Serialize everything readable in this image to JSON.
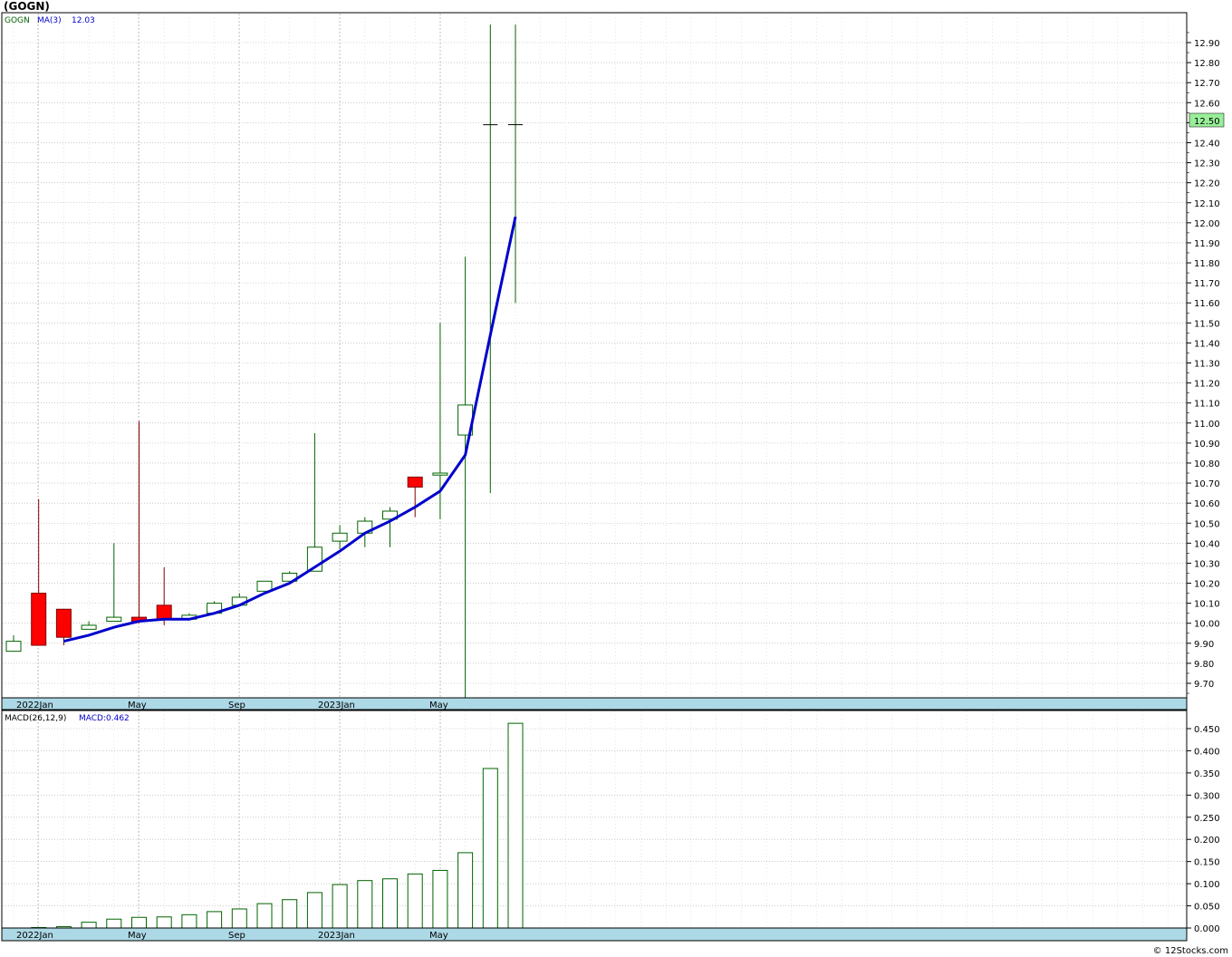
{
  "title": "(GOGN)",
  "footer": "© 12Stocks.com",
  "price_panel": {
    "legend_symbol": "GOGN",
    "legend_ma": "MA(3)",
    "legend_ma_value": "12.03",
    "last_price_label": "12.50",
    "y_ticks": [
      "9.70",
      "9.80",
      "9.90",
      "10.00",
      "10.10",
      "10.20",
      "10.30",
      "10.40",
      "10.50",
      "10.60",
      "10.70",
      "10.80",
      "10.90",
      "11.00",
      "11.10",
      "11.20",
      "11.30",
      "11.40",
      "11.50",
      "11.60",
      "11.70",
      "11.80",
      "11.90",
      "12.00",
      "12.10",
      "12.20",
      "12.30",
      "12.40",
      "12.50",
      "12.60",
      "12.70",
      "12.80",
      "12.90"
    ],
    "date_labels": [
      "2022Jan",
      "May",
      "Sep",
      "2023Jan",
      "May"
    ]
  },
  "macd_panel": {
    "legend_name": "MACD(26,12,9)",
    "legend_value": "MACD:0.462",
    "y_ticks": [
      "0.000",
      "0.050",
      "0.100",
      "0.150",
      "0.200",
      "0.250",
      "0.300",
      "0.350",
      "0.400",
      "0.450"
    ],
    "date_labels": [
      "2022Jan",
      "May",
      "Sep",
      "2023Jan",
      "May"
    ]
  },
  "colors": {
    "up_outline": "#006400",
    "down_fill": "#ff0000",
    "ma_line": "#0000cc",
    "last_price_bg": "#99ee99",
    "date_bar": "#add8e6",
    "grid": "#aaaaaa"
  },
  "chart_data": [
    {
      "type": "candlestick",
      "interval": "monthly",
      "x": [
        "2021-12",
        "2022-01",
        "2022-02",
        "2022-03",
        "2022-04",
        "2022-05",
        "2022-06",
        "2022-07",
        "2022-08",
        "2022-09",
        "2022-10",
        "2022-11",
        "2022-12",
        "2023-01",
        "2023-02",
        "2023-03",
        "2023-04",
        "2023-05",
        "2023-06",
        "2023-07",
        "2023-08"
      ],
      "open": [
        9.86,
        10.15,
        10.07,
        9.97,
        10.01,
        10.03,
        10.09,
        10.02,
        10.05,
        10.09,
        10.16,
        10.21,
        10.26,
        10.41,
        10.45,
        10.52,
        10.73,
        10.74,
        10.94,
        12.49,
        12.49
      ],
      "close": [
        9.91,
        9.89,
        9.93,
        9.99,
        10.03,
        10.01,
        10.02,
        10.04,
        10.1,
        10.13,
        10.21,
        10.25,
        10.38,
        10.45,
        10.51,
        10.56,
        10.68,
        10.75,
        11.09,
        12.49,
        12.49
      ],
      "high": [
        9.94,
        10.62,
        10.07,
        10.01,
        10.4,
        11.01,
        10.28,
        10.05,
        10.11,
        10.15,
        10.21,
        10.26,
        10.95,
        10.49,
        10.53,
        10.58,
        10.7,
        11.5,
        11.83,
        12.99,
        12.99
      ],
      "low": [
        9.86,
        9.89,
        9.89,
        9.97,
        10.01,
        10.0,
        9.99,
        10.02,
        10.05,
        10.09,
        10.16,
        10.21,
        10.26,
        10.37,
        10.38,
        10.38,
        10.53,
        10.52,
        9.63,
        10.65,
        11.6
      ],
      "ma3": [
        null,
        null,
        9.91,
        9.94,
        9.98,
        10.01,
        10.02,
        10.02,
        10.05,
        10.09,
        10.15,
        10.2,
        10.28,
        10.36,
        10.45,
        10.51,
        10.58,
        10.66,
        10.84,
        11.44,
        12.03
      ],
      "ylim": [
        9.63,
        13.0
      ]
    },
    {
      "type": "bar",
      "name": "MACD(26,12,9)",
      "x": [
        "2021-12",
        "2022-01",
        "2022-02",
        "2022-03",
        "2022-04",
        "2022-05",
        "2022-06",
        "2022-07",
        "2022-08",
        "2022-09",
        "2022-10",
        "2022-11",
        "2022-12",
        "2023-01",
        "2023-02",
        "2023-03",
        "2023-04",
        "2023-05",
        "2023-06",
        "2023-07",
        "2023-08"
      ],
      "values": [
        0.0,
        0.001,
        0.003,
        0.013,
        0.02,
        0.024,
        0.025,
        0.03,
        0.037,
        0.043,
        0.055,
        0.064,
        0.08,
        0.098,
        0.107,
        0.111,
        0.122,
        0.13,
        0.17,
        0.36,
        0.462
      ],
      "ylim": [
        0,
        0.46
      ]
    }
  ]
}
